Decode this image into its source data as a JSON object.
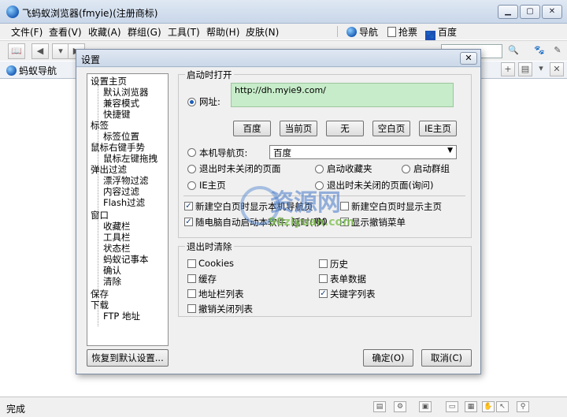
{
  "window": {
    "title": "飞蚂蚁浏览器(fmyie)(注册商标)"
  },
  "menu": [
    "文件(F)",
    "查看(V)",
    "收藏(A)",
    "群组(G)",
    "工具(T)",
    "帮助(H)",
    "皮肤(N)"
  ],
  "links": {
    "nav": "导航",
    "ticket": "抢票",
    "baidu": "百度"
  },
  "tab": {
    "label": "蚂蚁导航"
  },
  "status": {
    "text": "完成"
  },
  "dialog": {
    "title": "设置",
    "close": "✕",
    "tree": [
      "设置主页",
      "默认浏览器",
      "兼容模式",
      "快捷键",
      "标签",
      "标签位置",
      "鼠标右键手势",
      "鼠标左键拖拽",
      "弹出过滤",
      "漂浮物过滤",
      "内容过滤",
      "Flash过滤",
      "窗口",
      "收藏栏",
      "工具栏",
      "状态栏",
      "蚂蚁记事本",
      "确认",
      "清除",
      "保存",
      "下载",
      "FTP 地址"
    ],
    "startup": {
      "title": "启动时打开",
      "url_label": "网址:",
      "url_value": "http://dh.myie9.com/",
      "buttons": [
        "百度",
        "当前页",
        "无",
        "空白页",
        "IE主页"
      ],
      "local_nav_label": "本机导航页:",
      "local_nav_value": "百度",
      "opt_unclosed": "退出时未关闭的页面",
      "opt_favorites": "启动收藏夹",
      "opt_group": "启动群组",
      "opt_ie_home": "IE主页",
      "opt_unclosed_ask": "退出时未关闭的页面(询问)",
      "chk_new_blank_nav": "新建空白页时显示本机导航页",
      "chk_new_blank_home": "新建空白页时显示主页",
      "chk_autostart": "随电脑自动启动本软件, 延时(秒)",
      "autostart_delay": "80",
      "chk_undo_menu": "显示撤销菜单"
    },
    "clear": {
      "title": "退出时清除",
      "cookies": "Cookies",
      "history": "历史",
      "cache": "缓存",
      "form": "表单数据",
      "address_list": "地址栏列表",
      "keyword_list": "关键字列表",
      "undo_close_list": "撤销关闭列表"
    },
    "restore": "恢复到默认设置...",
    "ok": "确定(O)",
    "cancel": "取消(C)"
  },
  "watermark": {
    "name": "资源网",
    "url": "90ziyuan.com"
  }
}
